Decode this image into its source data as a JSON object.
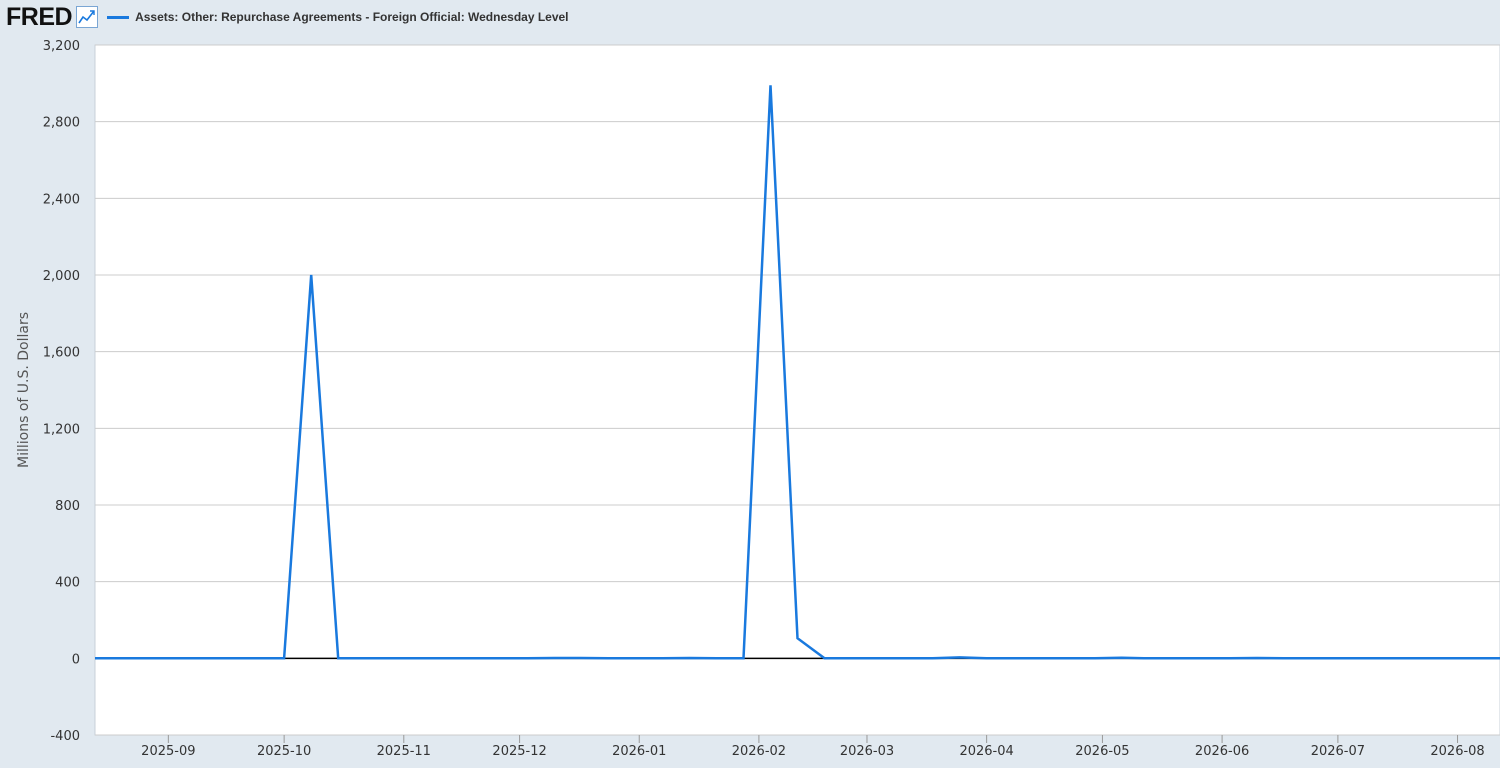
{
  "header": {
    "logo_text": "FRED",
    "series_label": "Assets: Other: Repurchase Agreements - Foreign Official: Wednesday Level"
  },
  "colors": {
    "background": "#e1e9f0",
    "plot_background": "#ffffff",
    "series": "#1979de",
    "zero_line": "#000000",
    "grid": "#cccccc"
  },
  "chart_data": {
    "type": "line",
    "title": "",
    "xlabel": "",
    "ylabel": "Millions of U.S. Dollars",
    "ylim": [
      -400,
      3200
    ],
    "yticks": [
      -400,
      0,
      400,
      800,
      1200,
      1600,
      2000,
      2400,
      2800,
      3200
    ],
    "ytick_labels": [
      "-400",
      "0",
      "400",
      "800",
      "1,200",
      "1,600",
      "2,000",
      "2,400",
      "2,800",
      "3,200"
    ],
    "xlim": [
      "2025-08-13",
      "2026-08-12"
    ],
    "xticks": [
      "2025-09-01",
      "2025-10-01",
      "2025-11-01",
      "2025-12-01",
      "2026-01-01",
      "2026-02-01",
      "2026-03-01",
      "2026-04-01",
      "2026-05-01",
      "2026-06-01",
      "2026-07-01",
      "2026-08-01"
    ],
    "xtick_labels": [
      "2025-09",
      "2025-10",
      "2025-11",
      "2025-12",
      "2026-01",
      "2026-02",
      "2026-03",
      "2026-04",
      "2026-05",
      "2026-06",
      "2026-07",
      "2026-08"
    ],
    "grid": true,
    "legend": "top-left",
    "series": [
      {
        "name": "Assets: Other: Repurchase Agreements - Foreign Official: Wednesday Level",
        "x": [
          "2025-08-13",
          "2025-08-20",
          "2025-08-27",
          "2025-09-03",
          "2025-09-10",
          "2025-09-17",
          "2025-09-24",
          "2025-10-01",
          "2025-10-08",
          "2025-10-15",
          "2025-10-22",
          "2025-10-29",
          "2025-11-05",
          "2025-11-12",
          "2025-11-19",
          "2025-11-26",
          "2025-12-03",
          "2025-12-10",
          "2025-12-17",
          "2025-12-24",
          "2025-12-31",
          "2026-01-07",
          "2026-01-14",
          "2026-01-21",
          "2026-01-28",
          "2026-02-04",
          "2026-02-11",
          "2026-02-18",
          "2026-02-25",
          "2026-03-04",
          "2026-03-11",
          "2026-03-18",
          "2026-03-25",
          "2026-04-01",
          "2026-04-08",
          "2026-04-15",
          "2026-04-22",
          "2026-04-29",
          "2026-05-06",
          "2026-05-13",
          "2026-05-20",
          "2026-05-27",
          "2026-06-03",
          "2026-06-10",
          "2026-06-17",
          "2026-06-24",
          "2026-07-01",
          "2026-07-08",
          "2026-07-15",
          "2026-07-22",
          "2026-07-29",
          "2026-08-05",
          "2026-08-12"
        ],
        "values": [
          0,
          0,
          0,
          0,
          0,
          0,
          0,
          0,
          2000,
          0,
          0,
          0,
          0,
          0,
          0,
          0,
          0,
          2,
          2,
          0,
          0,
          0,
          2,
          0,
          0,
          2990,
          105,
          0,
          0,
          0,
          0,
          0,
          5,
          0,
          0,
          0,
          0,
          0,
          3,
          0,
          0,
          0,
          0,
          2,
          0,
          0,
          0,
          0,
          0,
          0,
          0,
          0,
          0
        ]
      }
    ]
  }
}
